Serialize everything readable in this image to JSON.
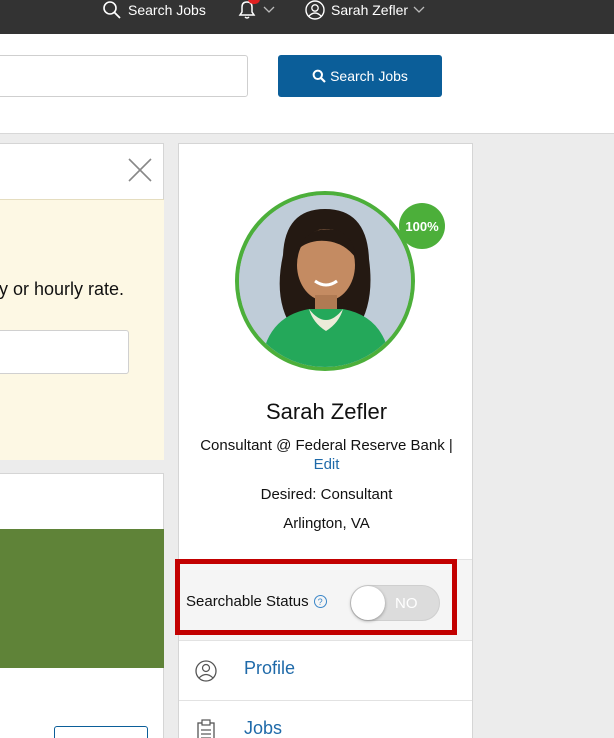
{
  "topbar": {
    "search_jobs_label": "Search Jobs",
    "user_name": "Sarah Zefler"
  },
  "search": {
    "button_label": "Search Jobs",
    "input_value": ""
  },
  "left_card": {
    "rate_text": "y or hourly rate."
  },
  "profile": {
    "completion": "100%",
    "name": "Sarah Zefler",
    "role": "Consultant @ Federal Reserve Bank |",
    "edit_label": "Edit",
    "desired": "Desired: Consultant",
    "location": "Arlington, VA",
    "searchable_status_label": "Searchable Status",
    "toggle_state": "NO"
  },
  "nav": {
    "profile_label": "Profile",
    "jobs_label": "Jobs"
  },
  "colors": {
    "topbar": "#333333",
    "primary_button": "#0b5e99",
    "link": "#1f6aa9",
    "completion_green": "#4caf3a",
    "highlight_red": "#c20000"
  }
}
